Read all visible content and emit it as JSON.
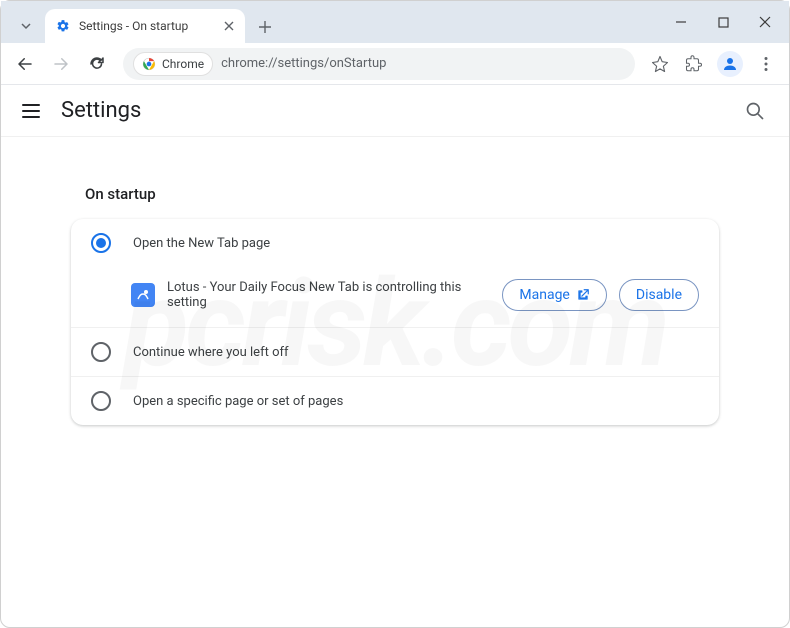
{
  "window": {
    "tab_title": "Settings - On startup",
    "url": "chrome://settings/onStartup",
    "chip_label": "Chrome"
  },
  "settings": {
    "header_title": "Settings",
    "section_title": "On startup",
    "options": [
      {
        "label": "Open the New Tab page",
        "selected": true
      },
      {
        "label": "Continue where you left off",
        "selected": false
      },
      {
        "label": "Open a specific page or set of pages",
        "selected": false
      }
    ],
    "extension_notice": "Lotus - Your Daily Focus New Tab is controlling this setting",
    "manage_label": "Manage",
    "disable_label": "Disable"
  },
  "watermark": "pcrisk.com"
}
